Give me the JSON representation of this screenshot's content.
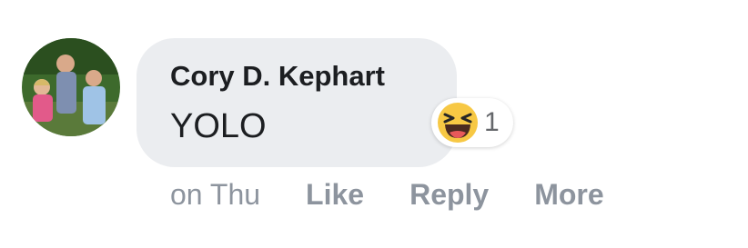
{
  "comment": {
    "author": "Cory D. Kephart",
    "text": "YOLO",
    "timestamp": "on Thu",
    "reaction": {
      "icon": "haha-reaction-icon",
      "count": "1"
    },
    "actions": {
      "like": "Like",
      "reply": "Reply",
      "more": "More"
    }
  },
  "colors": {
    "bubble_bg": "#ebedf0",
    "text": "#1c1e21",
    "muted": "#8d949e",
    "reaction_yellow": "#f7c844"
  }
}
